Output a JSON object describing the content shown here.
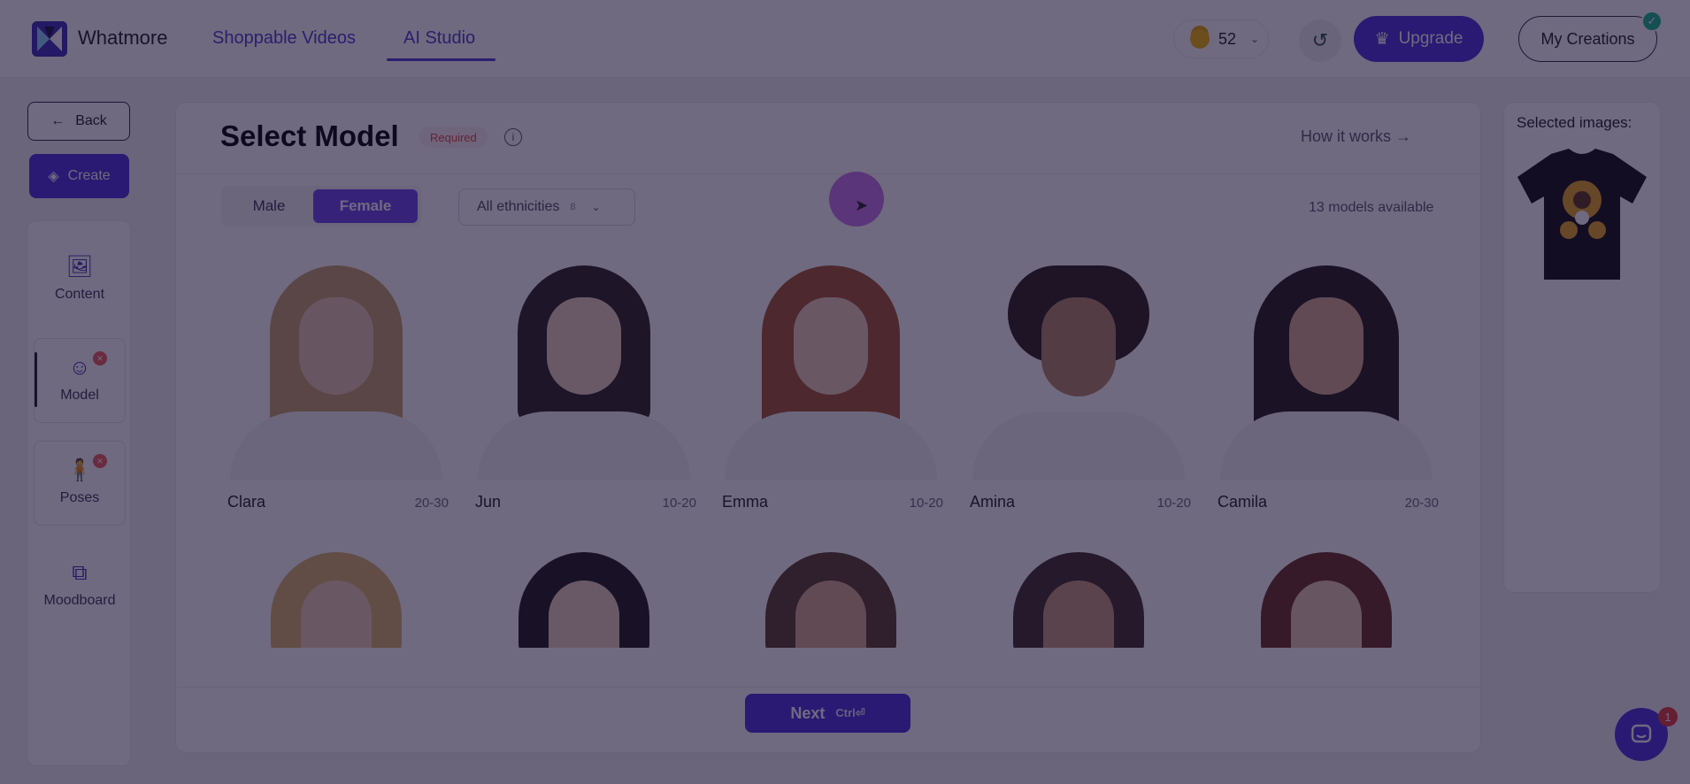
{
  "app": {
    "brand": "Whatmore"
  },
  "nav": {
    "tabs": [
      {
        "label": "Shoppable Videos"
      },
      {
        "label": "AI Studio"
      }
    ]
  },
  "header": {
    "coins": "52",
    "upgrade_label": "Upgrade",
    "my_creations_label": "My Creations"
  },
  "sidebar": {
    "back_label": "Back",
    "create_label": "Create",
    "items": [
      {
        "label": "Content",
        "icon": "image-icon"
      },
      {
        "label": "Model",
        "icon": "model-icon",
        "badge": true
      },
      {
        "label": "Poses",
        "icon": "person-icon",
        "badge": true
      },
      {
        "label": "Moodboard",
        "icon": "moodboard-icon"
      }
    ]
  },
  "main": {
    "title": "Select Model",
    "required_label": "Required",
    "how_it_works": "How it works →",
    "gender": {
      "male": "Male",
      "female": "Female",
      "selected": "Female"
    },
    "ethnicity": {
      "label": "All ethnicities",
      "count": "8"
    },
    "models_available": "13 models available",
    "models": [
      {
        "name": "Clara",
        "age": "20-30",
        "hair": "#c9a06a",
        "skin": "#e9cbb2"
      },
      {
        "name": "Jun",
        "age": "10-20",
        "hair": "#2a211c",
        "skin": "#efd3bd"
      },
      {
        "name": "Emma",
        "age": "10-20",
        "hair": "#a6532a",
        "skin": "#efcdb7"
      },
      {
        "name": "Amina",
        "age": "10-20",
        "hair": "#2b1d15",
        "skin": "#b98664"
      },
      {
        "name": "Camila",
        "age": "20-30",
        "hair": "#231a15",
        "skin": "#d9ab8c"
      }
    ],
    "models_row2": [
      {
        "hair": "#d9b46a",
        "skin": "#efcfb6"
      },
      {
        "hair": "#1f1a18",
        "skin": "#efd3bd"
      },
      {
        "hair": "#5a3a26",
        "skin": "#d9ab8c"
      },
      {
        "hair": "#3e2c22",
        "skin": "#c99879"
      },
      {
        "hair": "#6b2d20",
        "skin": "#ecc9b2"
      }
    ],
    "next_label": "Next",
    "next_shortcut": "Ctrl⏎"
  },
  "right": {
    "selected_images_label": "Selected images:"
  },
  "chat": {
    "badge": "1"
  }
}
